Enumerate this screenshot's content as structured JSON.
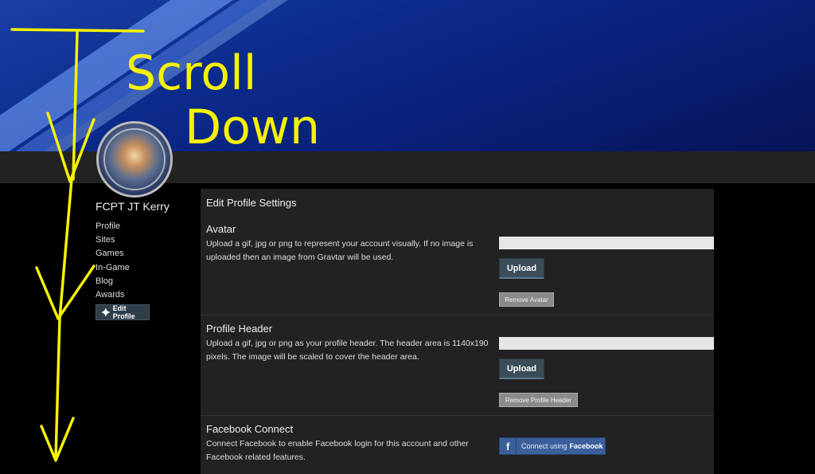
{
  "profile": {
    "name": "FCPT JT Kerry",
    "nav": [
      "Profile",
      "Sites",
      "Games",
      "In-Game",
      "Blog",
      "Awards"
    ],
    "edit_label": "Edit Profile"
  },
  "panel": {
    "title": "Edit Profile Settings",
    "avatar": {
      "heading": "Avatar",
      "desc": "Upload a gif, jpg or png to represent your account visually. If no image is uploaded then an image from Gravtar will be used.",
      "upload_label": "Upload",
      "remove_label": "Remove Avatar"
    },
    "header": {
      "heading": "Profile Header",
      "desc": "Upload a gif, jpg or png as your profile header. The header area is 1140x190 pixels. The image will be scaled to cover the header area.",
      "upload_label": "Upload",
      "remove_label": "Remove Profile Header"
    },
    "facebook": {
      "heading": "Facebook Connect",
      "desc": "Connect Facebook to enable Facebook login for this account and other Facebook related features.",
      "btn_prefix": "Connect using",
      "btn_brand": "Facebook"
    }
  },
  "annotation": {
    "line1": "Scroll",
    "line2": "Down"
  },
  "colors": {
    "banner": "#0b2b8c",
    "panel": "#222222",
    "annotation": "#f5f200"
  }
}
